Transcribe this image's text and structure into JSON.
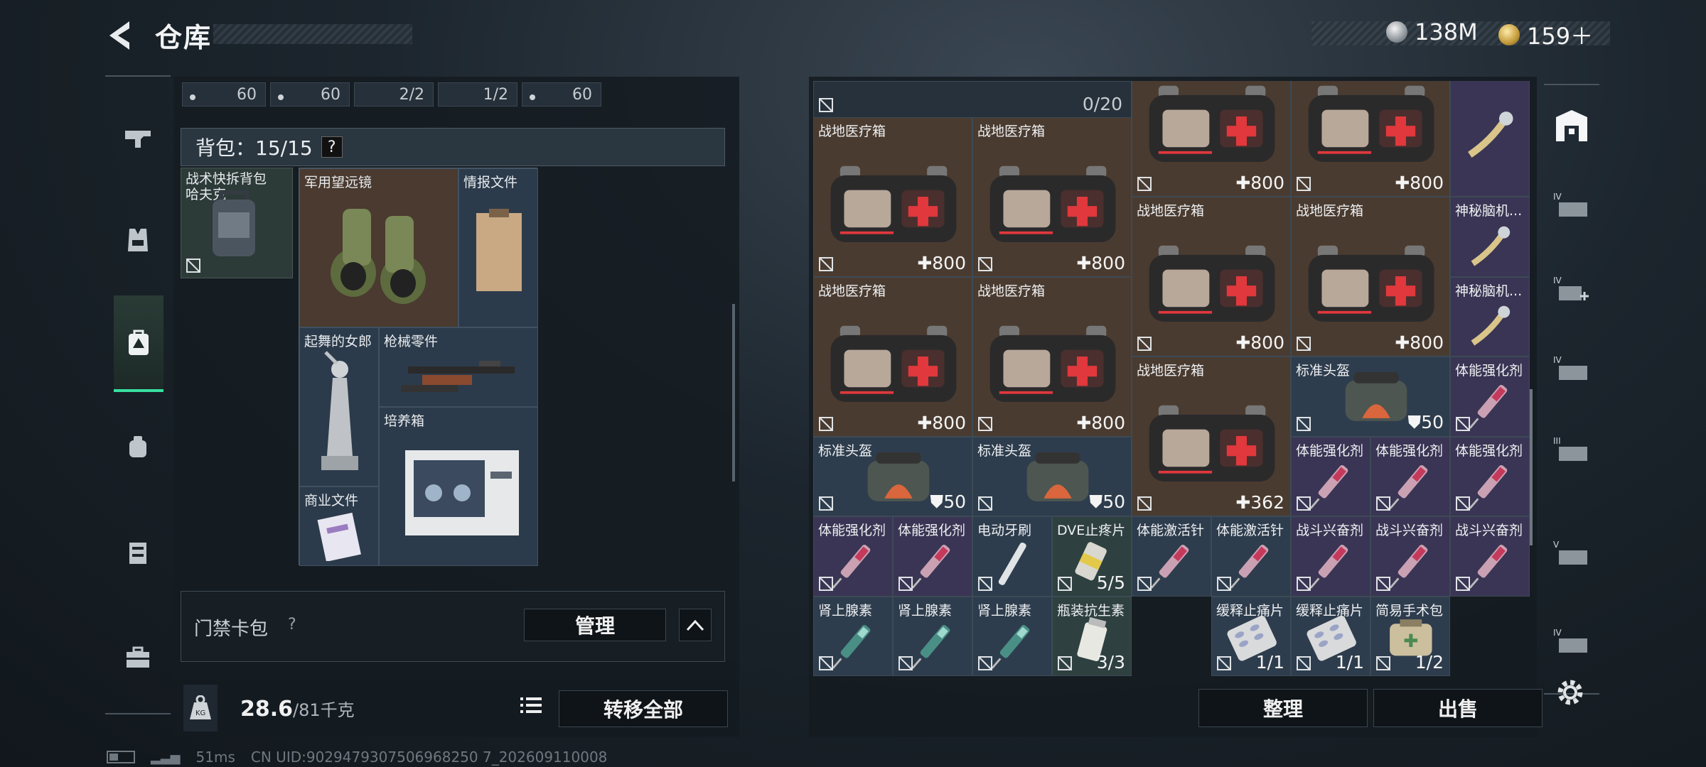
{
  "header": {
    "title": "仓库",
    "currency1": "138M",
    "currency2": "159＋"
  },
  "left": {
    "slots": [
      "60",
      "60",
      "2/2",
      "1/2",
      "60"
    ],
    "bag_label": "背包：15/15",
    "help": "?",
    "bag_item": "战术快拆背包\n哈夫克",
    "items": [
      "军用望远镜",
      "情报文件",
      "起舞的女郎",
      "枪械零件",
      "培养箱",
      "商业文件"
    ],
    "card_pack_label": "门禁卡包",
    "card_pack_help": "?",
    "manage": "管理",
    "weight_value": "28.6",
    "weight_max": "/81千克",
    "transfer_all": "转移全部"
  },
  "right": {
    "capacity": "0/20",
    "cells": [
      {
        "label": "战地医疗箱",
        "value": "800"
      },
      {
        "label": "战地医疗箱",
        "value": "800"
      },
      {
        "label": "",
        "value": "800"
      },
      {
        "label": "",
        "value": "800"
      },
      {
        "label": "神秘脑机...",
        "value": ""
      },
      {
        "label": "战地医疗箱",
        "value": "800"
      },
      {
        "label": "战地医疗箱",
        "value": "800"
      },
      {
        "label": "神秘脑机...",
        "value": ""
      },
      {
        "label": "战地医疗箱",
        "value": "800"
      },
      {
        "label": "战地医疗箱",
        "value": "800"
      },
      {
        "label": "神秘脑机...",
        "value": ""
      },
      {
        "label": "战地医疗箱",
        "value": "362"
      },
      {
        "label": "标准头盔",
        "value": "50"
      },
      {
        "label": "体能强化剂",
        "value": ""
      },
      {
        "label": "标准头盔",
        "value": "50"
      },
      {
        "label": "标准头盔",
        "value": "50"
      },
      {
        "label": "体能强化剂",
        "value": ""
      },
      {
        "label": "体能强化剂",
        "value": ""
      },
      {
        "label": "体能强化剂",
        "value": ""
      },
      {
        "label": "体能强化剂",
        "value": ""
      },
      {
        "label": "体能强化剂",
        "value": ""
      },
      {
        "label": "电动牙刷",
        "value": ""
      },
      {
        "label": "DVE止疼片",
        "value": "5/5"
      },
      {
        "label": "体能激活针",
        "value": ""
      },
      {
        "label": "体能激活针",
        "value": ""
      },
      {
        "label": "战斗兴奋剂",
        "value": ""
      },
      {
        "label": "战斗兴奋剂",
        "value": ""
      },
      {
        "label": "战斗兴奋剂",
        "value": ""
      },
      {
        "label": "肾上腺素",
        "value": ""
      },
      {
        "label": "肾上腺素",
        "value": ""
      },
      {
        "label": "肾上腺素",
        "value": ""
      },
      {
        "label": "瓶装抗生素",
        "value": "3/3"
      },
      {
        "label": "缓释止痛片",
        "value": "1/1"
      },
      {
        "label": "缓释止痛片",
        "value": "1/1"
      },
      {
        "label": "简易手术包",
        "value": "1/2"
      }
    ],
    "sort": "整理",
    "sell": "出售"
  },
  "status": {
    "ping": "51ms",
    "uid": "CN UID:9029479307506968250 7_202609110008"
  },
  "colors": {
    "accent": "#38e0a0",
    "medkit_red": "#e0383c"
  }
}
